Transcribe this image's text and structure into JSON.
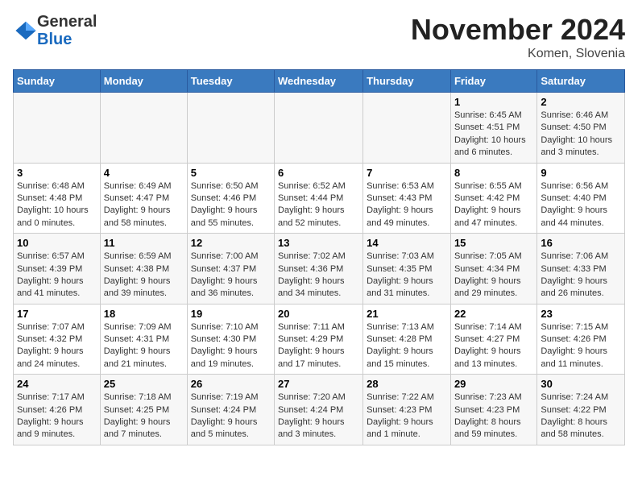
{
  "logo": {
    "general": "General",
    "blue": "Blue"
  },
  "title": "November 2024",
  "location": "Komen, Slovenia",
  "days_of_week": [
    "Sunday",
    "Monday",
    "Tuesday",
    "Wednesday",
    "Thursday",
    "Friday",
    "Saturday"
  ],
  "weeks": [
    [
      {
        "day": "",
        "sunrise": "",
        "sunset": "",
        "daylight": ""
      },
      {
        "day": "",
        "sunrise": "",
        "sunset": "",
        "daylight": ""
      },
      {
        "day": "",
        "sunrise": "",
        "sunset": "",
        "daylight": ""
      },
      {
        "day": "",
        "sunrise": "",
        "sunset": "",
        "daylight": ""
      },
      {
        "day": "",
        "sunrise": "",
        "sunset": "",
        "daylight": ""
      },
      {
        "day": "1",
        "sunrise": "Sunrise: 6:45 AM",
        "sunset": "Sunset: 4:51 PM",
        "daylight": "Daylight: 10 hours and 6 minutes."
      },
      {
        "day": "2",
        "sunrise": "Sunrise: 6:46 AM",
        "sunset": "Sunset: 4:50 PM",
        "daylight": "Daylight: 10 hours and 3 minutes."
      }
    ],
    [
      {
        "day": "3",
        "sunrise": "Sunrise: 6:48 AM",
        "sunset": "Sunset: 4:48 PM",
        "daylight": "Daylight: 10 hours and 0 minutes."
      },
      {
        "day": "4",
        "sunrise": "Sunrise: 6:49 AM",
        "sunset": "Sunset: 4:47 PM",
        "daylight": "Daylight: 9 hours and 58 minutes."
      },
      {
        "day": "5",
        "sunrise": "Sunrise: 6:50 AM",
        "sunset": "Sunset: 4:46 PM",
        "daylight": "Daylight: 9 hours and 55 minutes."
      },
      {
        "day": "6",
        "sunrise": "Sunrise: 6:52 AM",
        "sunset": "Sunset: 4:44 PM",
        "daylight": "Daylight: 9 hours and 52 minutes."
      },
      {
        "day": "7",
        "sunrise": "Sunrise: 6:53 AM",
        "sunset": "Sunset: 4:43 PM",
        "daylight": "Daylight: 9 hours and 49 minutes."
      },
      {
        "day": "8",
        "sunrise": "Sunrise: 6:55 AM",
        "sunset": "Sunset: 4:42 PM",
        "daylight": "Daylight: 9 hours and 47 minutes."
      },
      {
        "day": "9",
        "sunrise": "Sunrise: 6:56 AM",
        "sunset": "Sunset: 4:40 PM",
        "daylight": "Daylight: 9 hours and 44 minutes."
      }
    ],
    [
      {
        "day": "10",
        "sunrise": "Sunrise: 6:57 AM",
        "sunset": "Sunset: 4:39 PM",
        "daylight": "Daylight: 9 hours and 41 minutes."
      },
      {
        "day": "11",
        "sunrise": "Sunrise: 6:59 AM",
        "sunset": "Sunset: 4:38 PM",
        "daylight": "Daylight: 9 hours and 39 minutes."
      },
      {
        "day": "12",
        "sunrise": "Sunrise: 7:00 AM",
        "sunset": "Sunset: 4:37 PM",
        "daylight": "Daylight: 9 hours and 36 minutes."
      },
      {
        "day": "13",
        "sunrise": "Sunrise: 7:02 AM",
        "sunset": "Sunset: 4:36 PM",
        "daylight": "Daylight: 9 hours and 34 minutes."
      },
      {
        "day": "14",
        "sunrise": "Sunrise: 7:03 AM",
        "sunset": "Sunset: 4:35 PM",
        "daylight": "Daylight: 9 hours and 31 minutes."
      },
      {
        "day": "15",
        "sunrise": "Sunrise: 7:05 AM",
        "sunset": "Sunset: 4:34 PM",
        "daylight": "Daylight: 9 hours and 29 minutes."
      },
      {
        "day": "16",
        "sunrise": "Sunrise: 7:06 AM",
        "sunset": "Sunset: 4:33 PM",
        "daylight": "Daylight: 9 hours and 26 minutes."
      }
    ],
    [
      {
        "day": "17",
        "sunrise": "Sunrise: 7:07 AM",
        "sunset": "Sunset: 4:32 PM",
        "daylight": "Daylight: 9 hours and 24 minutes."
      },
      {
        "day": "18",
        "sunrise": "Sunrise: 7:09 AM",
        "sunset": "Sunset: 4:31 PM",
        "daylight": "Daylight: 9 hours and 21 minutes."
      },
      {
        "day": "19",
        "sunrise": "Sunrise: 7:10 AM",
        "sunset": "Sunset: 4:30 PM",
        "daylight": "Daylight: 9 hours and 19 minutes."
      },
      {
        "day": "20",
        "sunrise": "Sunrise: 7:11 AM",
        "sunset": "Sunset: 4:29 PM",
        "daylight": "Daylight: 9 hours and 17 minutes."
      },
      {
        "day": "21",
        "sunrise": "Sunrise: 7:13 AM",
        "sunset": "Sunset: 4:28 PM",
        "daylight": "Daylight: 9 hours and 15 minutes."
      },
      {
        "day": "22",
        "sunrise": "Sunrise: 7:14 AM",
        "sunset": "Sunset: 4:27 PM",
        "daylight": "Daylight: 9 hours and 13 minutes."
      },
      {
        "day": "23",
        "sunrise": "Sunrise: 7:15 AM",
        "sunset": "Sunset: 4:26 PM",
        "daylight": "Daylight: 9 hours and 11 minutes."
      }
    ],
    [
      {
        "day": "24",
        "sunrise": "Sunrise: 7:17 AM",
        "sunset": "Sunset: 4:26 PM",
        "daylight": "Daylight: 9 hours and 9 minutes."
      },
      {
        "day": "25",
        "sunrise": "Sunrise: 7:18 AM",
        "sunset": "Sunset: 4:25 PM",
        "daylight": "Daylight: 9 hours and 7 minutes."
      },
      {
        "day": "26",
        "sunrise": "Sunrise: 7:19 AM",
        "sunset": "Sunset: 4:24 PM",
        "daylight": "Daylight: 9 hours and 5 minutes."
      },
      {
        "day": "27",
        "sunrise": "Sunrise: 7:20 AM",
        "sunset": "Sunset: 4:24 PM",
        "daylight": "Daylight: 9 hours and 3 minutes."
      },
      {
        "day": "28",
        "sunrise": "Sunrise: 7:22 AM",
        "sunset": "Sunset: 4:23 PM",
        "daylight": "Daylight: 9 hours and 1 minute."
      },
      {
        "day": "29",
        "sunrise": "Sunrise: 7:23 AM",
        "sunset": "Sunset: 4:23 PM",
        "daylight": "Daylight: 8 hours and 59 minutes."
      },
      {
        "day": "30",
        "sunrise": "Sunrise: 7:24 AM",
        "sunset": "Sunset: 4:22 PM",
        "daylight": "Daylight: 8 hours and 58 minutes."
      }
    ]
  ]
}
